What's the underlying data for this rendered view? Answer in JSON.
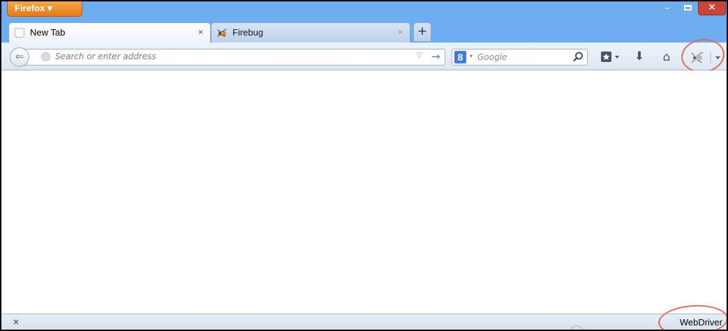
{
  "window": {
    "app_button_label": "Firefox ▾",
    "minimize_glyph": "–",
    "close_glyph": "✕"
  },
  "tabs": [
    {
      "label": "New Tab",
      "close_glyph": "×",
      "icon": "blank-page-icon",
      "active": true
    },
    {
      "label": "Firebug",
      "close_glyph": "×",
      "icon": "firebug-icon",
      "active": false
    }
  ],
  "newtab_glyph": "+",
  "navbar": {
    "back_glyph": "⇐",
    "url_placeholder": "Search or enter address",
    "url_dropdown_glyph": "▽",
    "go_glyph": "→",
    "search_engine_letter": "8",
    "search_engine_dropdown": "▾",
    "search_placeholder": "Google",
    "downloads_glyph": "⬇",
    "home_glyph": "⌂"
  },
  "statusbar": {
    "close_glyph": "×",
    "text": "WebDriver"
  },
  "colors": {
    "chrome_blue": "#6eaef0",
    "firefox_orange": "#e4791a",
    "close_red": "#c7463c",
    "annotation_red": "#e86a57"
  }
}
